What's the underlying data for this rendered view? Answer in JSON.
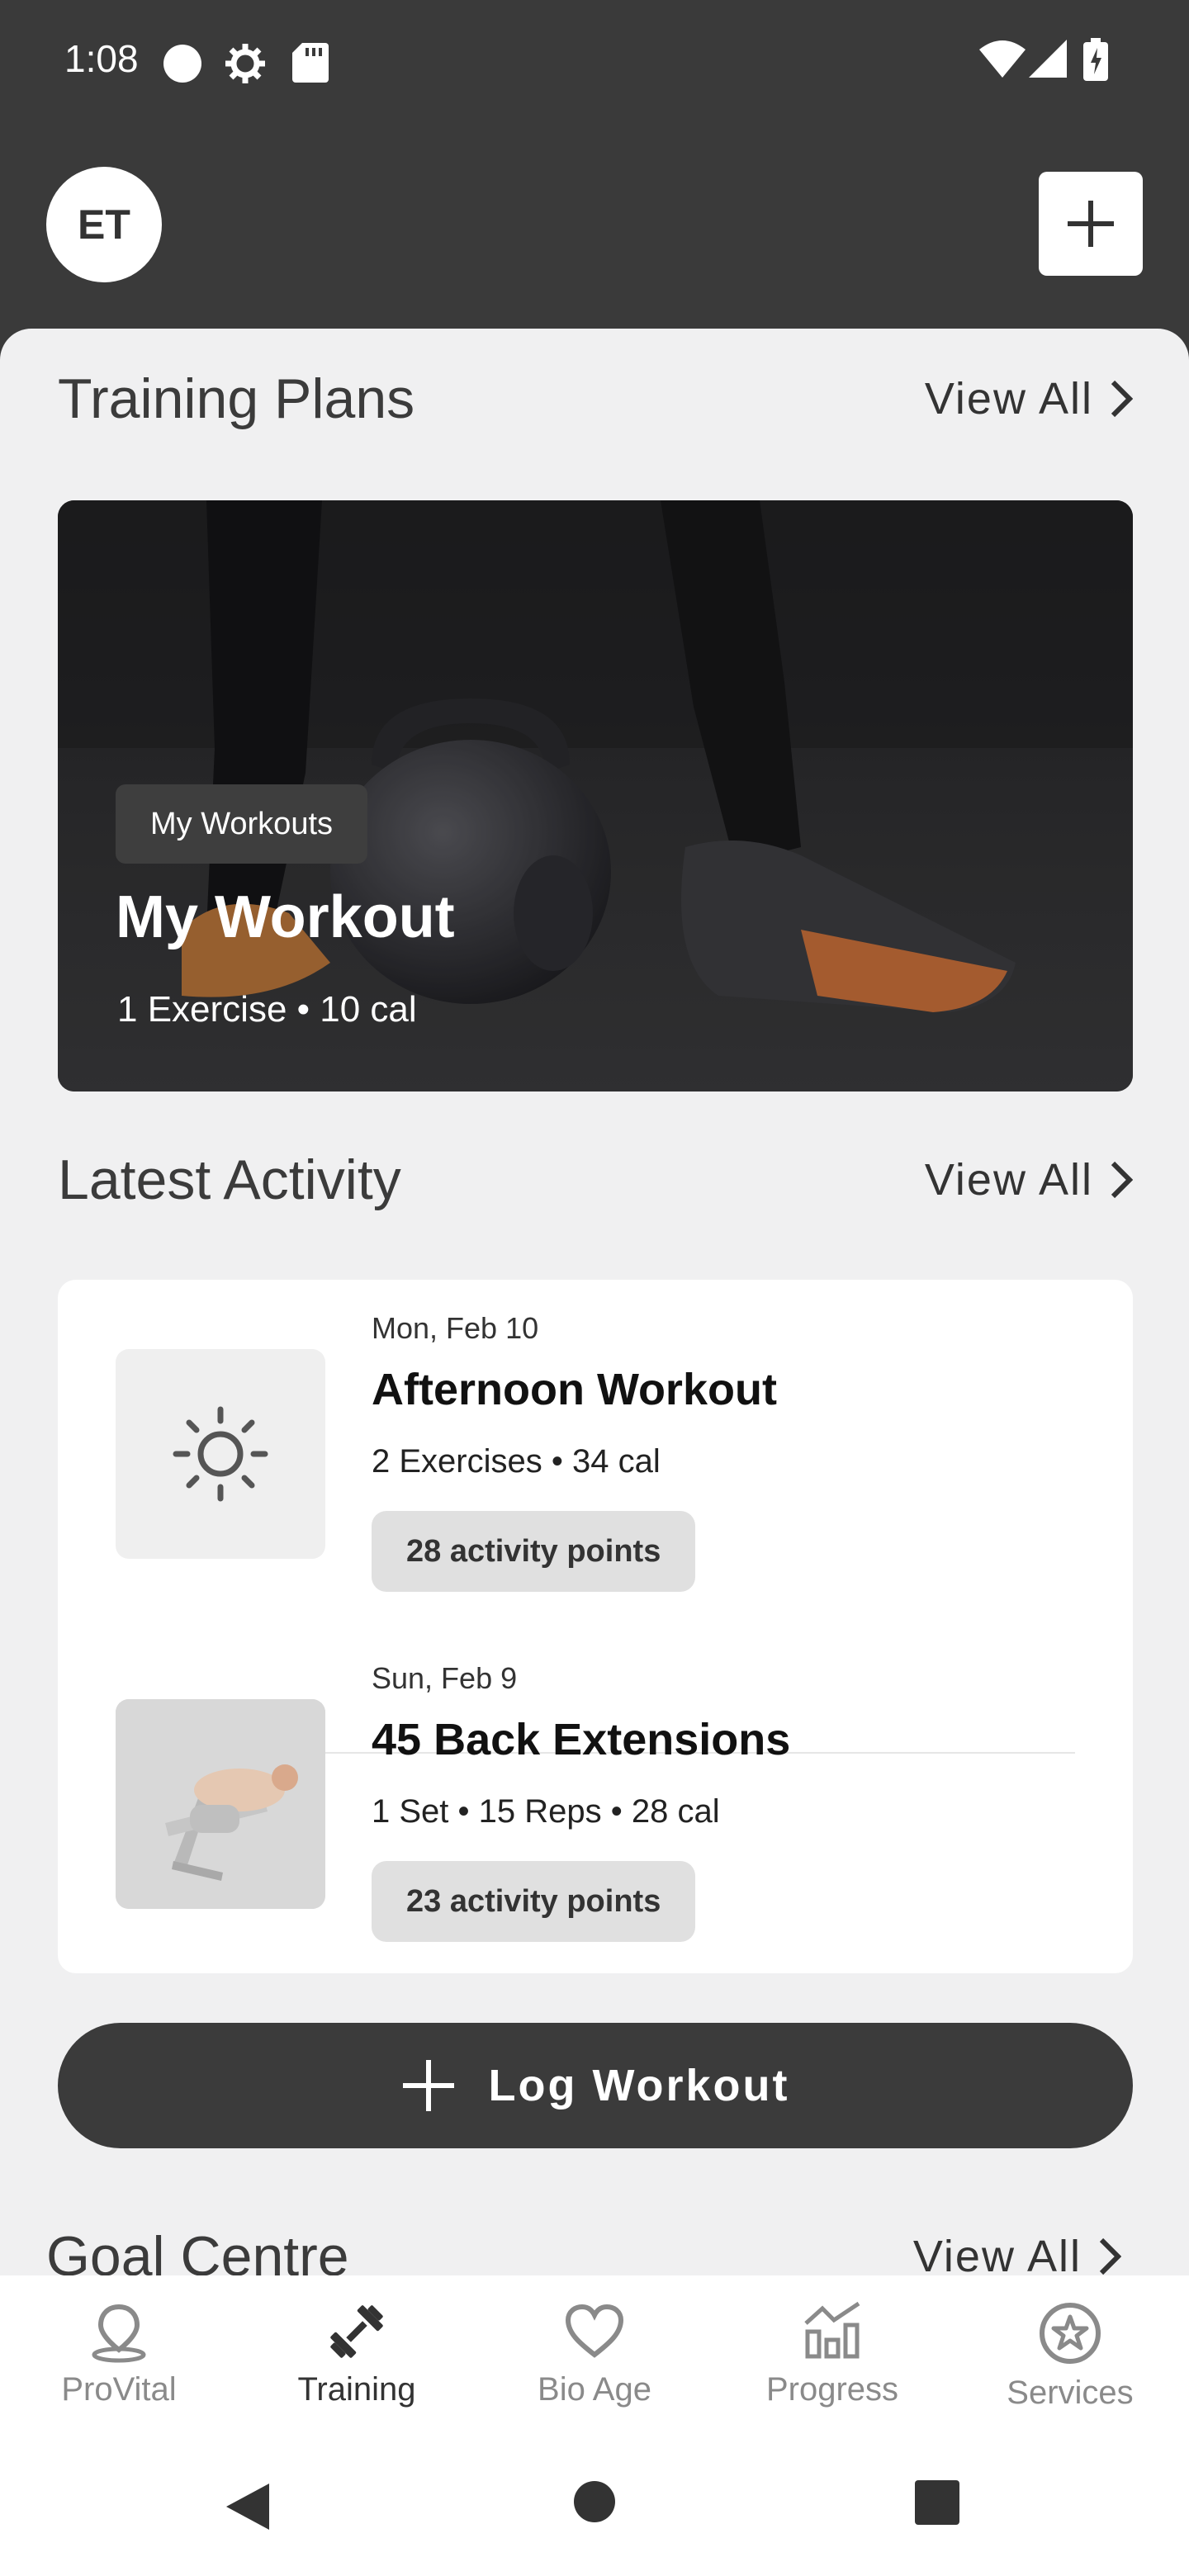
{
  "status_bar": {
    "time": "1:08"
  },
  "header": {
    "avatar_initials": "ET"
  },
  "training_plans": {
    "title": "Training Plans",
    "view_all": "View All",
    "card": {
      "tag": "My Workouts",
      "title": "My Workout",
      "meta": "1 Exercise • 10 cal"
    }
  },
  "latest_activity": {
    "title": "Latest Activity",
    "view_all": "View All",
    "items": [
      {
        "date": "Mon, Feb 10",
        "title": "Afternoon Workout",
        "meta": "2 Exercises • 34 cal",
        "points": "28 activity points",
        "icon": "sun-icon"
      },
      {
        "date": "Sun, Feb 9",
        "title": "45 Back Extensions",
        "meta": "1 Set • 15 Reps • 28 cal",
        "points": "23 activity points",
        "icon": "back-extension-thumbnail"
      }
    ]
  },
  "log_workout": {
    "label": "Log Workout"
  },
  "goal_centre": {
    "title": "Goal Centre",
    "view_all": "View All"
  },
  "bottom_nav": {
    "items": [
      {
        "label": "ProVital",
        "icon": "location-pin-icon",
        "active": false
      },
      {
        "label": "Training",
        "icon": "dumbbell-icon",
        "active": true
      },
      {
        "label": "Bio Age",
        "icon": "heart-icon",
        "active": false
      },
      {
        "label": "Progress",
        "icon": "bar-chart-icon",
        "active": false
      },
      {
        "label": "Services",
        "icon": "star-badge-icon",
        "active": false
      }
    ]
  },
  "colors": {
    "dark": "#3b3b3b",
    "background": "#f0f0f1",
    "card": "#ffffff",
    "inactive": "#8a8a8a"
  }
}
